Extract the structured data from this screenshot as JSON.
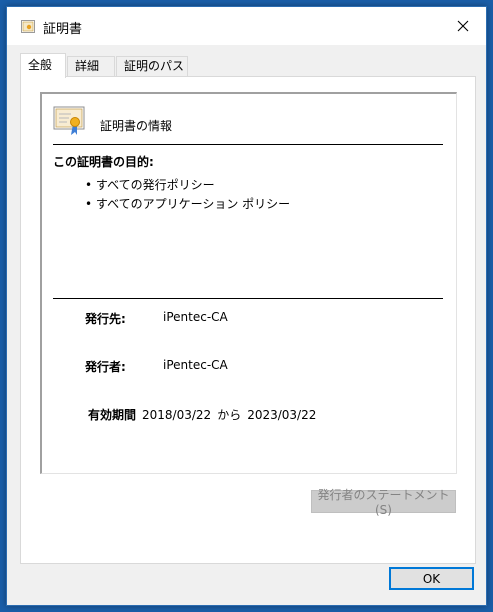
{
  "window": {
    "title": "証明書"
  },
  "tabs": [
    {
      "label": "全般"
    },
    {
      "label": "詳細"
    },
    {
      "label": "証明のパス"
    }
  ],
  "general": {
    "section_title": "証明書の情報",
    "purpose_title": "この証明書の目的:",
    "purposes": [
      "すべての発行ポリシー",
      "すべてのアプリケーション ポリシー"
    ],
    "issued_to_label": "発行先:",
    "issued_to_value": "iPentec-CA",
    "issued_by_label": "発行者:",
    "issued_by_value": "iPentec-CA",
    "validity_label": "有効期間",
    "valid_from": "2018/03/22",
    "valid_from_to": "から",
    "valid_to": "2023/03/22",
    "statement_button": "発行者のステートメント(S)"
  },
  "footer": {
    "ok_label": "OK"
  },
  "colors": {
    "accent": "#0078d7",
    "desktop": "#1a5ea8"
  },
  "icons": {
    "title": "certificate-icon",
    "close": "close-icon",
    "cert": "certificate-ribbon-icon"
  }
}
